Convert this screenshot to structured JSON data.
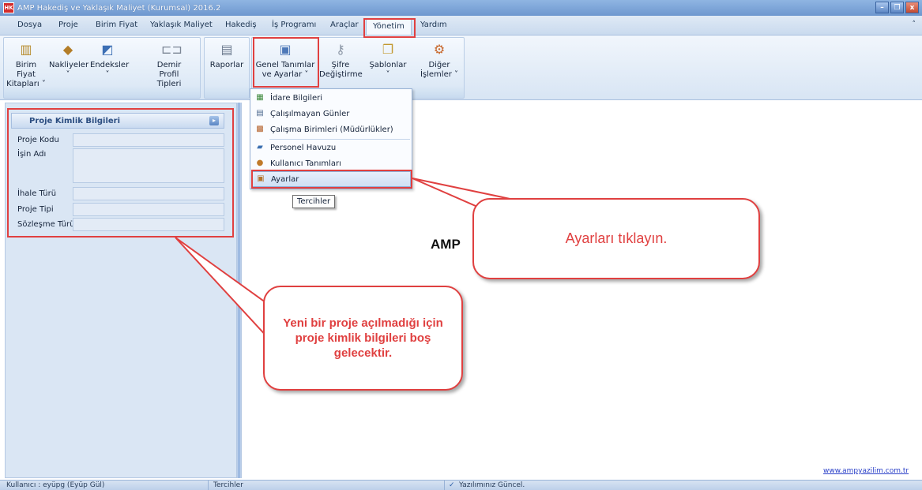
{
  "window": {
    "app_icon": "HK",
    "title": "AMP Hakediş ve Yaklaşık Maliyet (Kurumsal) 2016.2",
    "minimize": "–",
    "restore": "❐",
    "close": "x"
  },
  "menu": {
    "items": [
      "Dosya",
      "Proje",
      "Birim Fiyat",
      "Yaklaşık Maliyet",
      "Hakediş",
      "İş Programı",
      "Araçlar",
      "Yönetim",
      "Yardım"
    ],
    "active": "Yönetim",
    "collapse_caret": "˄"
  },
  "ribbon": {
    "buttons": [
      {
        "label1": "Birim Fiyat",
        "label2": "Kitapları ˅",
        "icon": "books-icon"
      },
      {
        "label1": "Nakliyeler",
        "label2": "˅",
        "icon": "box-icon"
      },
      {
        "label1": "Endeksler",
        "label2": "˅",
        "icon": "chart-icon"
      },
      {
        "label1": "Demir Profil",
        "label2": "Tipleri",
        "icon": "rebar-icon"
      },
      {
        "label1": "Raporlar",
        "label2": "",
        "icon": "printer-icon"
      },
      {
        "label1": "Genel Tanımlar",
        "label2": "ve Ayarlar ˅",
        "icon": "settings-doc-icon"
      },
      {
        "label1": "Şifre",
        "label2": "Değiştirme",
        "icon": "key-icon"
      },
      {
        "label1": "Şablonlar",
        "label2": "˅",
        "icon": "template-icon"
      },
      {
        "label1": "Diğer",
        "label2": "İşlemler ˅",
        "icon": "gear-icon"
      }
    ]
  },
  "dropdown": {
    "items": [
      {
        "label": "İdare Bilgileri",
        "icon": "building-icon"
      },
      {
        "label": "Çalışılmayan Günler",
        "icon": "calendar-icon"
      },
      {
        "label": "Çalışma Birimleri (Müdürlükler)",
        "icon": "units-icon"
      },
      {
        "label": "Personel Havuzu",
        "icon": "staff-icon"
      },
      {
        "label": "Kullanıcı Tanımları",
        "icon": "users-icon"
      },
      {
        "label": "Ayarlar",
        "icon": "settings-icon"
      }
    ],
    "tooltip": "Tercihler"
  },
  "project_panel": {
    "title": "Proje Kimlik Bilgileri",
    "fields": [
      {
        "label": "Proje Kodu",
        "value": ""
      },
      {
        "label": "İşin Adı",
        "value": ""
      },
      {
        "label": "İhale Türü",
        "value": ""
      },
      {
        "label": "Proje Tipi",
        "value": ""
      },
      {
        "label": "Sözleşme Türü",
        "value": ""
      }
    ]
  },
  "main": {
    "brand_text": "AMP",
    "website": "www.ampyazilim.com.tr"
  },
  "status": {
    "user": "Kullanıcı : eyüpg  (Eyüp Gül)",
    "section": "Tercihler",
    "update": "Yazılımınız Güncel."
  },
  "annotations": {
    "callout_settings": "Ayarları tıklayın.",
    "callout_project": "Yeni bir proje açılmadığı için proje kimlik bilgileri boş gelecektir.",
    "accent_color": "#e04040"
  }
}
